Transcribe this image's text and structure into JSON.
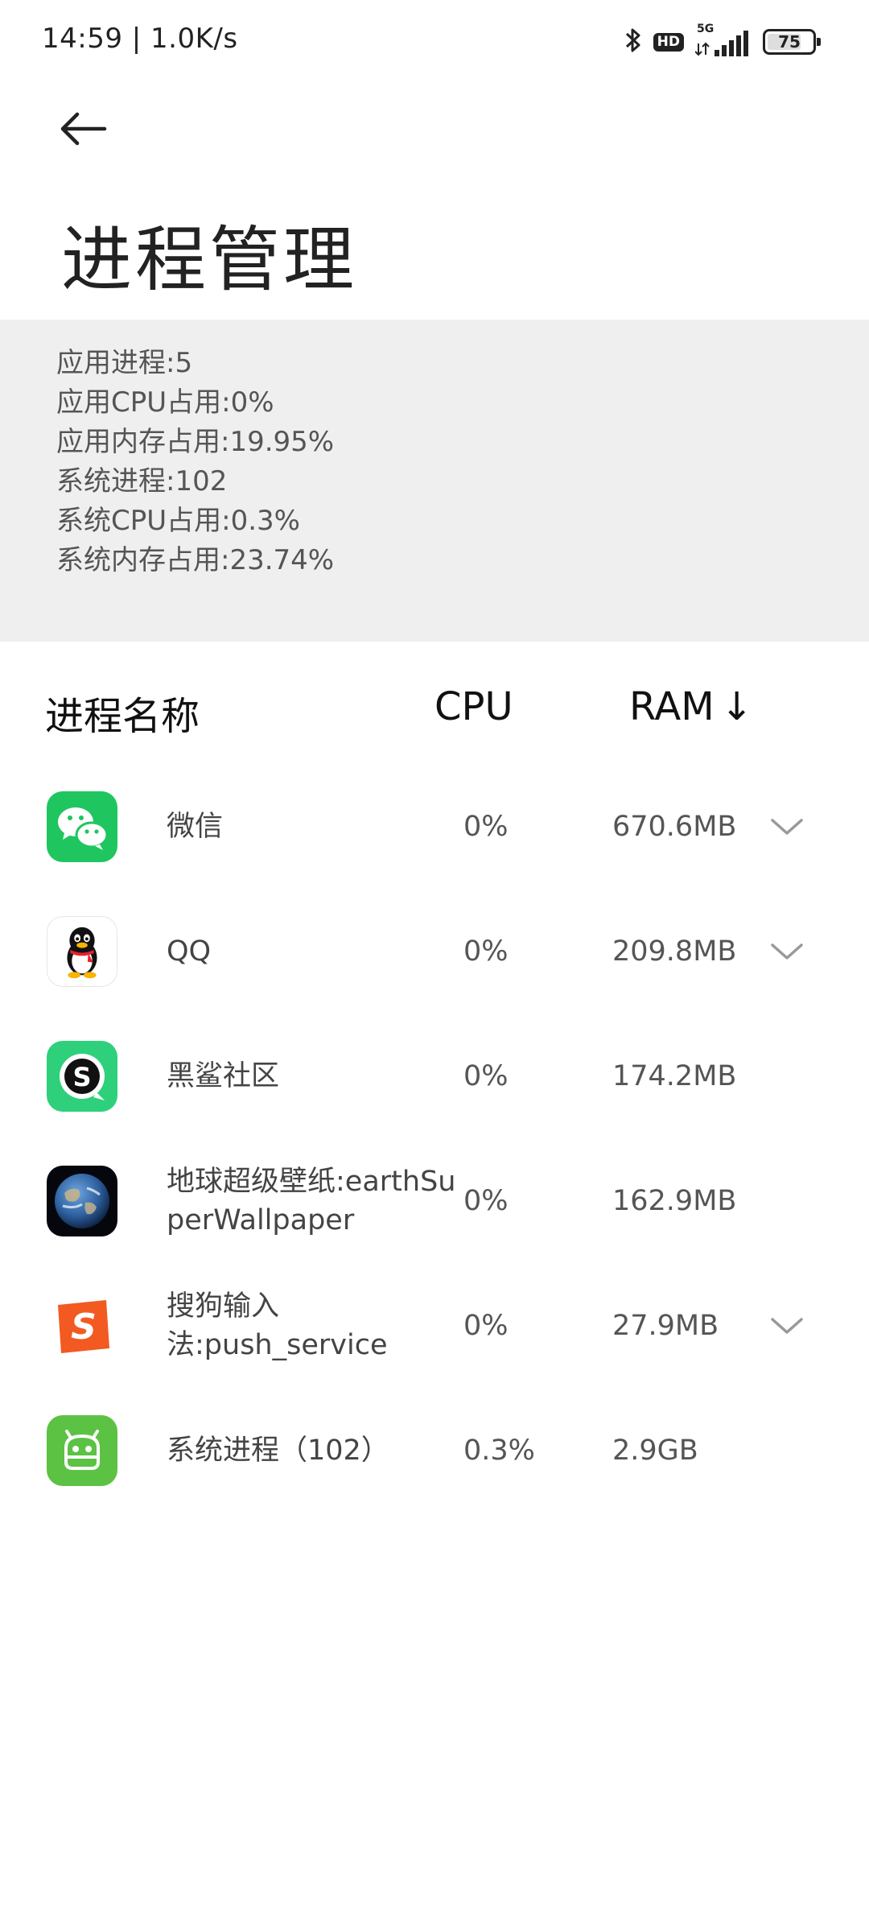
{
  "status_bar": {
    "time_speed": "14:59 | 1.0K/s",
    "network": "5G",
    "hd": "HD",
    "battery": "75",
    "battery_level": 0.75
  },
  "header": {
    "title": "进程管理"
  },
  "summary": {
    "lines": [
      "应用进程:5",
      "应用CPU占用:0%",
      "应用内存占用:19.95%",
      "系统进程:102",
      "系统CPU占用:0.3%",
      "系统内存占用:23.74%"
    ]
  },
  "table": {
    "columns": {
      "name": "进程名称",
      "cpu": "CPU",
      "ram": "RAM",
      "sort_indicator": "↓"
    },
    "rows": [
      {
        "name": "微信",
        "cpu": "0%",
        "ram": "670.6MB",
        "icon": "wechat-icon",
        "expandable": true
      },
      {
        "name": "QQ",
        "cpu": "0%",
        "ram": "209.8MB",
        "icon": "qq-icon",
        "expandable": true
      },
      {
        "name": "黑鲨社区",
        "cpu": "0%",
        "ram": "174.2MB",
        "icon": "blackshark-community-icon",
        "expandable": false
      },
      {
        "name": "地球超级壁纸:earthSuperWallpaper",
        "name_line1": "地球超级壁纸:earthSu",
        "name_line2": "perWallpaper",
        "cpu": "0%",
        "ram": "162.9MB",
        "icon": "earth-wallpaper-icon",
        "expandable": false
      },
      {
        "name": "搜狗输入法:push_service",
        "name_line1": "搜狗输入",
        "name_line2": "法:push_service",
        "cpu": "0%",
        "ram": "27.9MB",
        "icon": "sogou-input-icon",
        "expandable": true
      },
      {
        "name": "系统进程（102）",
        "cpu": "0.3%",
        "ram": "2.9GB",
        "icon": "android-system-icon",
        "expandable": false
      }
    ]
  },
  "colors": {
    "summary_bg": "#efefef",
    "wechat_green": "#1fc660",
    "blackshark_green": "#2fd07c",
    "android_green": "#5cc243",
    "sogou_orange": "#f25a22"
  }
}
